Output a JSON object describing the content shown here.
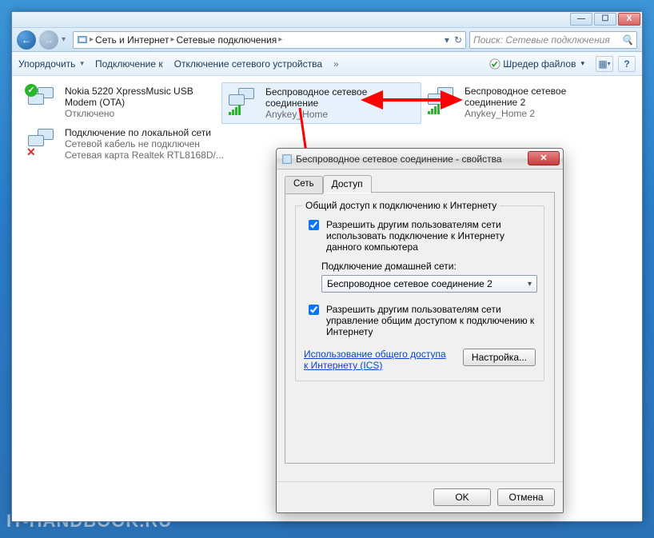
{
  "watermark": "IT-HANDBOOK.RU",
  "window_controls": {
    "min": "—",
    "max": "☐",
    "close": "X"
  },
  "address_bar": {
    "seg1": "Сеть и Интернет",
    "seg2": "Сетевые подключения"
  },
  "search": {
    "placeholder": "Поиск: Сетевые подключения"
  },
  "toolbar": {
    "organize": "Упорядочить",
    "connect": "Подключение к",
    "disable": "Отключение сетевого устройства",
    "shredder": "Шредер файлов"
  },
  "connections": [
    {
      "name": "Nokia 5220 XpressMusic USB Modem (OTA)",
      "sub1": "Отключено",
      "sub2": "",
      "kind": "modem",
      "selected": false
    },
    {
      "name": "Беспроводное сетевое соединение",
      "sub1": "Anykey_Home",
      "sub2": "",
      "kind": "wifi",
      "selected": true
    },
    {
      "name": "Беспроводное сетевое соединение 2",
      "sub1": "Anykey_Home 2",
      "sub2": "",
      "kind": "wifi",
      "selected": false
    },
    {
      "name": "Подключение по локальной сети",
      "sub1": "Сетевой кабель не подключен",
      "sub2": "Сетевая карта Realtek RTL8168D/...",
      "kind": "lan-down",
      "selected": false
    }
  ],
  "dialog": {
    "title": "Беспроводное сетевое соединение - свойства",
    "tab_network": "Сеть",
    "tab_sharing": "Доступ",
    "group_legend": "Общий доступ к подключению к Интернету",
    "chk1": "Разрешить другим пользователям сети использовать подключение к Интернету данного компьютера",
    "homenet_label": "Подключение домашней сети:",
    "homenet_value": "Беспроводное сетевое соединение 2",
    "chk2": "Разрешить другим пользователям сети управление общим доступом к подключению к Интернету",
    "ics_link": "Использование общего доступа к Интернету (ICS)",
    "settings_btn": "Настройка...",
    "ok": "OK",
    "cancel": "Отмена"
  }
}
